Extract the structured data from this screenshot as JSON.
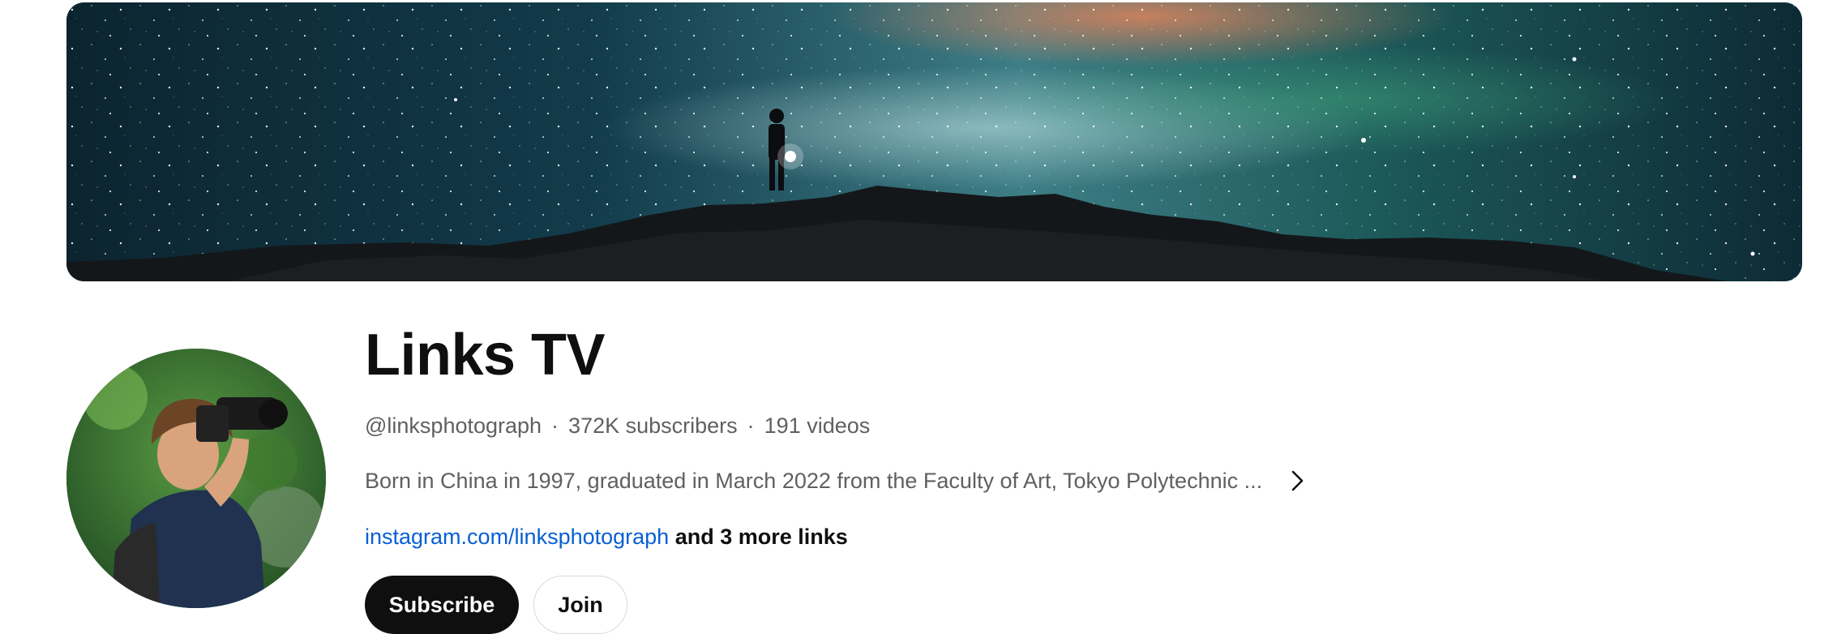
{
  "channel": {
    "name": "Links TV",
    "handle": "@linksphotograph",
    "subscribers": "372K subscribers",
    "videos": "191 videos",
    "separator": "·",
    "description": "Born in China in 1997, graduated in March 2022 from the Faculty of Art, Tokyo Polytechnic ...",
    "link_text": "instagram.com/linksphotograph",
    "more_links_text": "and 3 more links"
  },
  "buttons": {
    "subscribe_label": "Subscribe",
    "join_label": "Join"
  },
  "icons": {
    "more_description": "chevron-right-icon"
  },
  "colors": {
    "link": "#065fd4",
    "subscribe_bg": "#0f0f0f",
    "secondary_text": "#606060",
    "primary_text": "#0f0f0f"
  }
}
